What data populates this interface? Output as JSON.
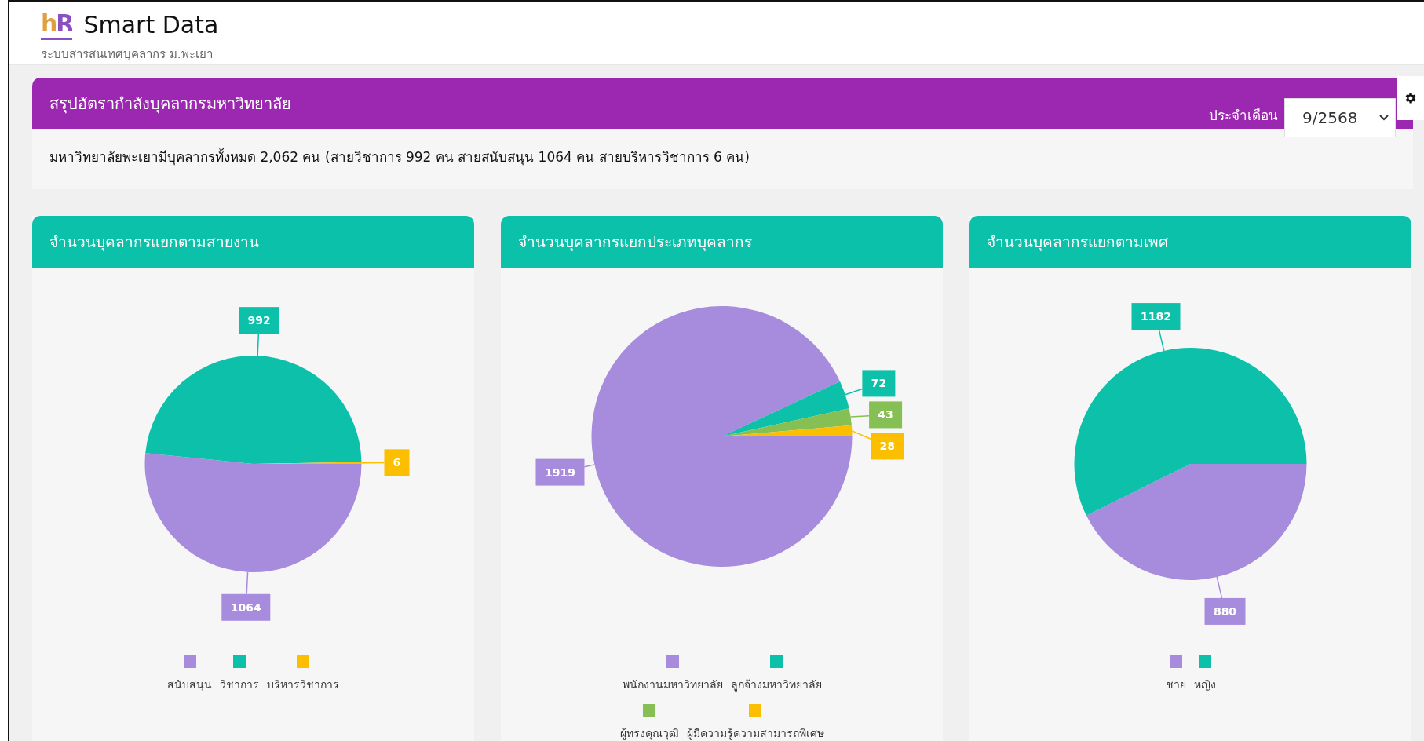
{
  "header": {
    "logo": "hR",
    "title": "Smart Data",
    "subtitle": "ระบบสารสนเทศบุคลากร ม.พะเยา"
  },
  "summary": {
    "title": "สรุปอัตรากำลังบุคลากรมหาวิทยาลัย",
    "month_label": "ประจำเดือน",
    "month_value": "9/2568",
    "text": "มหาวิทยาลัยพะเยามีบุคลากรทั้งหมด 2,062 คน (สายวิชาการ 992 คน สายสนับสนุน 1064 คน สายบริหารวิชาการ 6 คน)"
  },
  "cards": [
    {
      "title": "จำนวนบุคลากรแยกตามสายงาน",
      "legend": [
        {
          "color": "#a78bdc"
        },
        {
          "color": "#0cc0aa"
        },
        {
          "color": "#fbbf00"
        }
      ],
      "chart_data": {
        "type": "pie",
        "categories": [
          "สนับสนุน",
          "วิชาการ",
          "บริหารวิชาการ"
        ],
        "values": [
          1064,
          992,
          6
        ],
        "data_labels": true
      }
    },
    {
      "title": "จำนวนบุคลากรแยกประเภทบุคลากร",
      "legend": [
        {
          "color": "#a78bdc"
        },
        {
          "color": "#0cc0aa"
        },
        {
          "color": "#86c054"
        },
        {
          "color": "#fbbf00"
        }
      ],
      "chart_data": {
        "type": "pie",
        "categories": [
          "พนักงานมหาวิทยาลัย",
          "ลูกจ้างมหาวิทยาลัย",
          "ผู้ทรงคุณวุฒิ",
          "ผู้มีความรู้ความสามารถพิเศษ"
        ],
        "values": [
          1919,
          72,
          43,
          28
        ],
        "data_labels": true
      }
    },
    {
      "title": "จำนวนบุคลากรแยกตามเพศ",
      "legend": [
        {
          "color": "#a78bdc"
        },
        {
          "color": "#0cc0aa"
        }
      ],
      "chart_data": {
        "type": "pie",
        "categories": [
          "ชาย",
          "หญิง"
        ],
        "values": [
          880,
          1182
        ],
        "data_labels": true
      }
    }
  ]
}
